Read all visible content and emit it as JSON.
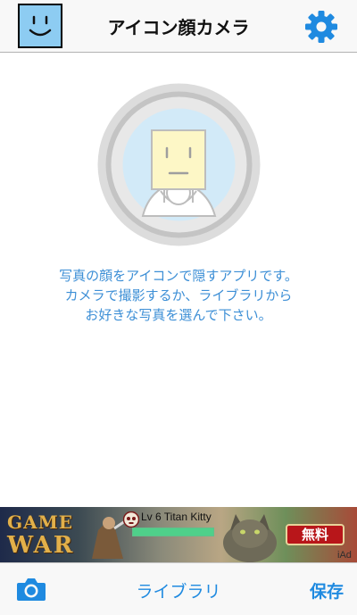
{
  "app": {
    "title": "アイコン顔カメラ"
  },
  "header": {
    "avatar_icon": "smiley-face-icon",
    "settings_icon": "gear-icon",
    "accent_color": "#1f8ae0"
  },
  "main": {
    "illustration_icon": "face-mask-portrait-icon",
    "description_lines": [
      "写真の顔をアイコンで隠すアプリです。",
      "カメラで撮影するか、ライブラリから",
      "お好きな写真を選んで下さい。"
    ]
  },
  "ad": {
    "game_title_line1": "GAME",
    "game_title_line2": "WAR",
    "level_text": "Lv 6 Titan Kitty",
    "badge_text": "無料",
    "provider": "iAd"
  },
  "toolbar": {
    "camera_icon": "camera-icon",
    "library_label": "ライブラリ",
    "save_label": "保存"
  }
}
